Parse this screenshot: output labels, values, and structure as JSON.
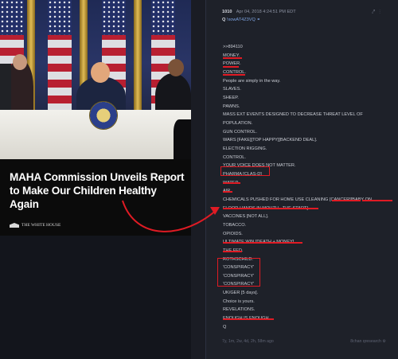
{
  "article": {
    "headline": "MAHA Commission Unveils Report to Make Our Children Healthy Again",
    "source": "THE WHITE HOUSE"
  },
  "post": {
    "number": "1010",
    "date": "Apr 04, 2018 4:24:51 PM EDT",
    "q": "Q",
    "tripcode": "!xowAT4Z3VQ",
    "icons": [
      "share-icon",
      "menu-icon"
    ],
    "lines": [
      ">>894110",
      "MONEY.",
      "POWER.",
      "CONTROL.",
      "People are simply in the way.",
      "SLAVES.",
      "SHEEP.",
      "PAWNS.",
      "MASS EXT EVENTS DESIGNED TO DECREASE THREAT LEVEL OF",
      "POPULATION.",
      "GUN CONTROL.",
      "WARS [FAKE][TOP HAPPY][BACKEND DEAL].",
      "ELECTION RIGGING.",
      "CONTROL.",
      "YOUR VOICE DOES NOT MATTER.",
      "PHARMA [CLAS-D]",
      "WATER",
      "AIR",
      "CHEMICALS PUSHED FOR HOME USE CLEANING [CANCER][BABY ON",
      "FLOOR-HANDS IN MOUTH - THE START].",
      "VACCINES [NOT ALL].",
      "TOBACCO.",
      "OPIOIDS.",
      "ULTIMATE WIN [DEATH + MONEY].",
      "THE FED.",
      "ROTHSCHILD.",
      "'CONSPIRACY'",
      "'CONSPIRACY'",
      "'CONSPIRACY'",
      "UK/GER [5 days].",
      "Choice is yours.",
      "REVELATIONS.",
      "ENOUGH IS ENOUGH.",
      "Q"
    ],
    "footer_left": "7y, 1m, 2w, 4d, 2h, 58m ago",
    "footer_right": "8chan qresearch"
  },
  "colors": {
    "annotation": "#e01b24",
    "post_bg": "#1e2129",
    "page_bg": "#13151c"
  }
}
